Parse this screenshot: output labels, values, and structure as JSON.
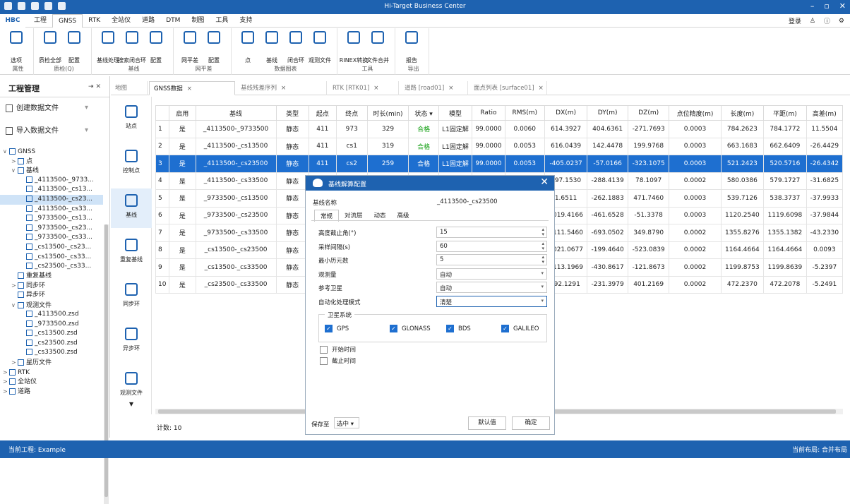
{
  "app": {
    "title": "Hi-Target Business Center"
  },
  "menu": {
    "hbc": "HBC",
    "tabs": [
      "工程",
      "GNSS",
      "RTK",
      "全站仪",
      "道路",
      "DTM",
      "制图",
      "工具",
      "支持"
    ],
    "login": "登录"
  },
  "ribbon": {
    "groups": [
      {
        "label": "属性",
        "buttons": [
          "选项"
        ]
      },
      {
        "label": "质检(Q)",
        "buttons": [
          "质检全部",
          "配置"
        ]
      },
      {
        "label": "基线",
        "buttons": [
          "基线处理",
          "搜索闭合环",
          "配置"
        ]
      },
      {
        "label": "网平差",
        "buttons": [
          "网平差",
          "配置"
        ]
      },
      {
        "label": "数据图表",
        "buttons": [
          "点",
          "基线",
          "闭合环",
          "观测文件"
        ]
      },
      {
        "label": "工具",
        "buttons": [
          "RINEX转换",
          "文件合并"
        ]
      },
      {
        "label": "导出",
        "buttons": [
          "报告"
        ]
      }
    ]
  },
  "left_panel": {
    "title": "工程管理",
    "pin": "⇥ ✕",
    "create_file": "创建数据文件",
    "import_file": "导入数据文件",
    "tree": [
      {
        "text": "GNSS",
        "level": 0,
        "arrow": "∨"
      },
      {
        "text": "点",
        "level": 1,
        "arrow": ">"
      },
      {
        "text": "基线",
        "level": 1,
        "arrow": "∨"
      },
      {
        "text": "_4113500-_9733...",
        "level": 2,
        "arrow": ""
      },
      {
        "text": "_4113500-_cs13...",
        "level": 2,
        "arrow": ""
      },
      {
        "text": "_4113500-_cs23...",
        "level": 2,
        "arrow": "",
        "selected": true
      },
      {
        "text": "_4113500-_cs33...",
        "level": 2,
        "arrow": ""
      },
      {
        "text": "_9733500-_cs13...",
        "level": 2,
        "arrow": ""
      },
      {
        "text": "_9733500-_cs23...",
        "level": 2,
        "arrow": ""
      },
      {
        "text": "_9733500-_cs33...",
        "level": 2,
        "arrow": ""
      },
      {
        "text": "_cs13500-_cs23...",
        "level": 2,
        "arrow": ""
      },
      {
        "text": "_cs13500-_cs33...",
        "level": 2,
        "arrow": ""
      },
      {
        "text": "_cs23500-_cs33...",
        "level": 2,
        "arrow": ""
      },
      {
        "text": "重复基线",
        "level": 1,
        "arrow": ""
      },
      {
        "text": "同步环",
        "level": 1,
        "arrow": ">"
      },
      {
        "text": "异步环",
        "level": 1,
        "arrow": ""
      },
      {
        "text": "观测文件",
        "level": 1,
        "arrow": "∨"
      },
      {
        "text": "_4113500.zsd",
        "level": 2,
        "arrow": ""
      },
      {
        "text": "_9733500.zsd",
        "level": 2,
        "arrow": ""
      },
      {
        "text": "_cs13500.zsd",
        "level": 2,
        "arrow": ""
      },
      {
        "text": "_cs23500.zsd",
        "level": 2,
        "arrow": ""
      },
      {
        "text": "_cs33500.zsd",
        "level": 2,
        "arrow": ""
      },
      {
        "text": "星历文件",
        "level": 1,
        "arrow": ">"
      },
      {
        "text": "RTK",
        "level": 0,
        "arrow": ">"
      },
      {
        "text": "全站仪",
        "level": 0,
        "arrow": ">"
      },
      {
        "text": "道路",
        "level": 0,
        "arrow": ">"
      }
    ]
  },
  "doc_tabs": [
    "地图",
    "GNSS数据",
    "基线残差序列",
    "RTK [RTK01]",
    "道路 [road01]",
    "面点列表 [surface01]"
  ],
  "side_icons": [
    "站点",
    "控制点",
    "基线",
    "重复基线",
    "同步环",
    "异步环",
    "观测文件"
  ],
  "grid": {
    "headers": [
      "",
      "启用",
      "基线",
      "类型",
      "起点",
      "终点",
      "时长(min)",
      "状态 ▾",
      "模型",
      "Ratio",
      "RMS(m)",
      "DX(m)",
      "DY(m)",
      "DZ(m)",
      "点位精度(m)",
      "长度(m)",
      "平距(m)",
      "高差(m)"
    ],
    "rows": [
      [
        "1",
        "是",
        "_4113500-_9733500",
        "静态",
        "411",
        "973",
        "329",
        "合格",
        "L1固定解",
        "99.0000",
        "0.0060",
        "614.3927",
        "404.6361",
        "-271.7693",
        "0.0003",
        "784.2623",
        "784.1772",
        "11.5504"
      ],
      [
        "2",
        "是",
        "_4113500-_cs13500",
        "静态",
        "411",
        "cs1",
        "319",
        "合格",
        "L1固定解",
        "99.0000",
        "0.0053",
        "616.0439",
        "142.4478",
        "199.9768",
        "0.0003",
        "663.1683",
        "662.6409",
        "-26.4429"
      ],
      [
        "3",
        "是",
        "_4113500-_cs23500",
        "静态",
        "411",
        "cs2",
        "259",
        "合格",
        "L1固定解",
        "99.0000",
        "0.0053",
        "-405.0237",
        "-57.0166",
        "-323.1075",
        "0.0003",
        "521.2423",
        "520.5716",
        "-26.4342"
      ],
      [
        "4",
        "是",
        "_4113500-_cs33500",
        "静态",
        "411",
        "",
        "",
        "",
        "",
        "",
        "",
        "497.1530",
        "-288.4139",
        "78.1097",
        "0.0002",
        "580.0386",
        "579.1727",
        "-31.6825"
      ],
      [
        "5",
        "是",
        "_9733500-_cs13500",
        "静态",
        "",
        "",
        "",
        "",
        "",
        "",
        "",
        "1.6511",
        "-262.1883",
        "471.7460",
        "0.0003",
        "539.7126",
        "538.3737",
        "-37.9933"
      ],
      [
        "6",
        "是",
        "_9733500-_cs23500",
        "静态",
        "",
        "",
        "",
        "",
        "",
        "",
        "",
        "1019.4166",
        "-461.6528",
        "-51.3378",
        "0.0003",
        "1120.2540",
        "1119.6098",
        "-37.9844"
      ],
      [
        "7",
        "是",
        "_9733500-_cs33500",
        "静态",
        "",
        "",
        "",
        "",
        "",
        "",
        "",
        "1111.5460",
        "-693.0502",
        "349.8790",
        "0.0002",
        "1355.8276",
        "1355.1382",
        "-43.2330"
      ],
      [
        "8",
        "是",
        "_cs13500-_cs23500",
        "静态",
        "",
        "",
        "",
        "",
        "",
        "",
        "",
        "1021.0677",
        "-199.4640",
        "-523.0839",
        "0.0002",
        "1164.4664",
        "1164.4664",
        "0.0093"
      ],
      [
        "9",
        "是",
        "_cs13500-_cs33500",
        "静态",
        "",
        "",
        "",
        "",
        "",
        "",
        "",
        "1113.1969",
        "-430.8617",
        "-121.8673",
        "0.0002",
        "1199.8753",
        "1199.8639",
        "-5.2397"
      ],
      [
        "10",
        "是",
        "_cs23500-_cs33500",
        "静态",
        "",
        "",
        "",
        "",
        "",
        "",
        "",
        "-92.1291",
        "-231.3979",
        "401.2169",
        "0.0002",
        "472.2370",
        "472.2078",
        "-5.2491"
      ]
    ],
    "selected_row": 3,
    "footer": "计数: 10"
  },
  "dialog": {
    "title": "基线解算配置",
    "name_label": "基线名称",
    "name_value": "_4113500-_cs23500",
    "tabs": [
      "常规",
      "对流层",
      "动态",
      "高级"
    ],
    "fields": [
      {
        "label": "高度截止角(°)",
        "value": "15",
        "kind": "spin"
      },
      {
        "label": "采样间隔(s)",
        "value": "60",
        "kind": "spin"
      },
      {
        "label": "最小历元数",
        "value": "5",
        "kind": "spin"
      },
      {
        "label": "观测量",
        "value": "自动",
        "kind": "select"
      },
      {
        "label": "参考卫星",
        "value": "自动",
        "kind": "select"
      },
      {
        "label": "自动化处理模式",
        "value": "清楚",
        "kind": "select"
      }
    ],
    "sat_caption": "卫星系统",
    "sats": [
      {
        "label": "GPS",
        "on": true
      },
      {
        "label": "GLONASS",
        "on": true
      },
      {
        "label": "BDS",
        "on": true
      },
      {
        "label": "GALILEO",
        "on": true
      }
    ],
    "start_time": "开始时间",
    "end_time": "截止时间",
    "save_label": "保存至",
    "save_value": "选中",
    "default_btn": "默认值",
    "ok_btn": "确定"
  },
  "status": {
    "left": "当前工程: Example",
    "right": "当前布局: 合并布局"
  },
  "colors": {
    "primary": "#1e62b0",
    "selected_row": "#1e6fd0",
    "ok_green": "#15a015"
  }
}
